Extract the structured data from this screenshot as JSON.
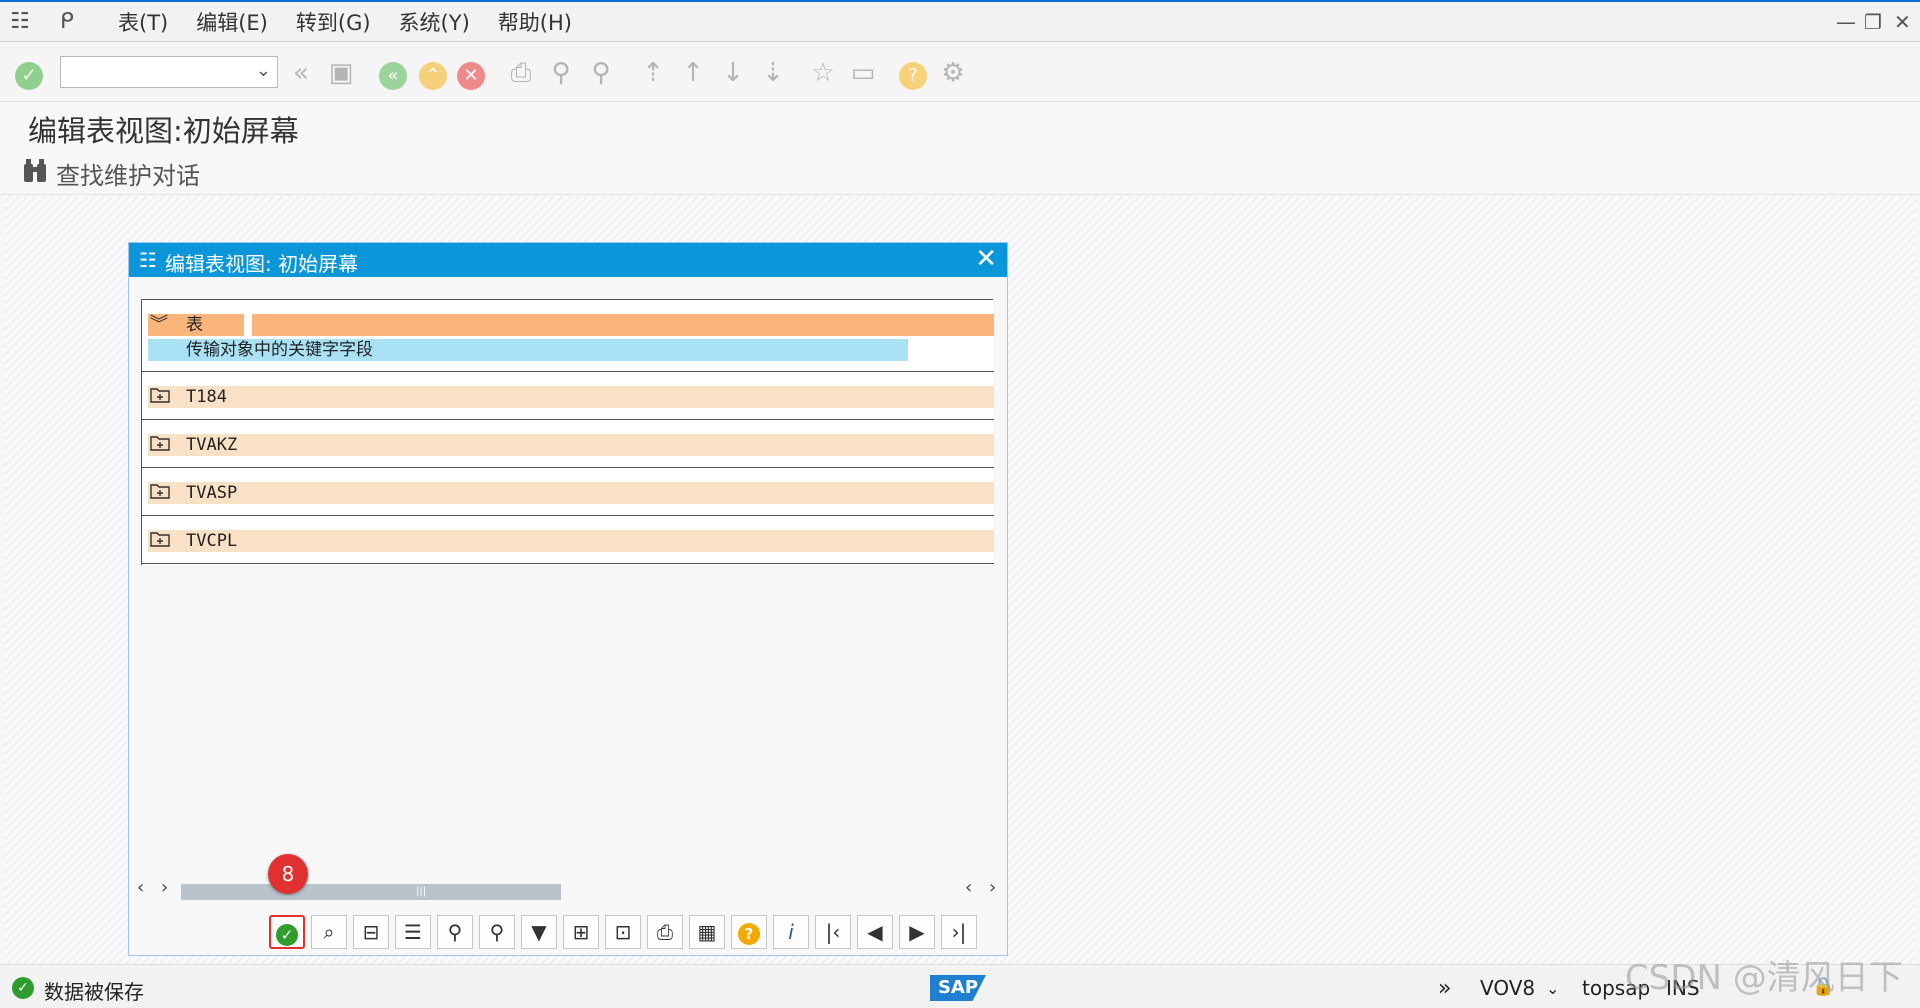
{
  "menu": {
    "items": [
      "表(T)",
      "编辑(E)",
      "转到(G)",
      "系统(Y)",
      "帮助(H)"
    ]
  },
  "toolbar": {
    "command_field_value": ""
  },
  "page": {
    "title": "编辑表视图:初始屏幕",
    "find_label": "查找维护对话"
  },
  "dialog": {
    "title": "编辑表视图: 初始屏幕",
    "tree": {
      "root_label": "表",
      "root_description": "传输对象中的关键字字段",
      "items": [
        "T184",
        "TVAKZ",
        "TVASP",
        "TVCPL"
      ]
    },
    "step_badge": "8"
  },
  "status": {
    "message": "数据被保存",
    "transaction": "VOV8",
    "user": "topsap",
    "mode": "INS",
    "sap_logo": "SAP"
  },
  "watermark": "CSDN @清风日下",
  "colors": {
    "accent": "#0a96d8",
    "root_highlight": "#f9b57a",
    "desc_highlight": "#a9e2f5",
    "row_highlight": "#f9e1c6",
    "ok_green": "#2e9d2e",
    "badge_red": "#e03030"
  }
}
